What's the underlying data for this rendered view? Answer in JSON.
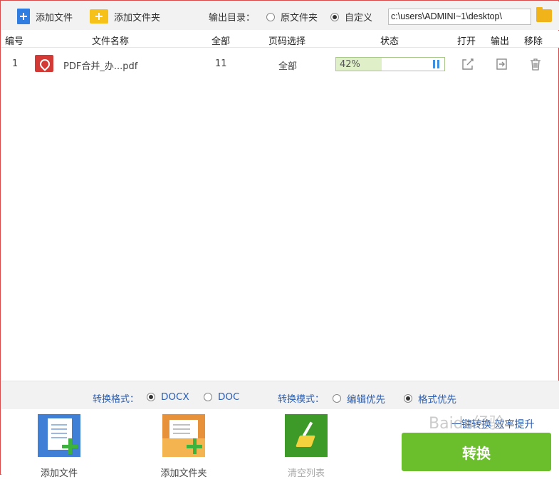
{
  "toolbar": {
    "add_file_label": "添加文件",
    "add_folder_label": "添加文件夹",
    "output_dir_label": "输出目录：",
    "radio_original": "原文件夹",
    "radio_custom": "自定义",
    "output_path": "c:\\users\\ADMINI~1\\desktop\\",
    "selected_output": "custom"
  },
  "table": {
    "headers": {
      "index": "编号",
      "filename": "文件名称",
      "total": "全部",
      "page_select": "页码选择",
      "status": "状态",
      "open": "打开",
      "output": "输出",
      "remove": "移除"
    },
    "rows": [
      {
        "index": "1",
        "filename": "PDF合并_办...pdf",
        "total": "11",
        "page_select": "全部",
        "progress_text": "42%",
        "progress": 0.42
      }
    ]
  },
  "options": {
    "format_label": "转换格式：",
    "format_docx": "DOCX",
    "format_doc": "DOC",
    "selected_format": "DOCX",
    "mode_label": "转换模式：",
    "mode_edit": "编辑优先",
    "mode_format": "格式优先",
    "selected_mode": "格式优先"
  },
  "footer": {
    "add_file_label": "添加文件",
    "add_folder_label": "添加文件夹",
    "clear_list_label": "清空列表",
    "slogan": "一键转换  效率提升",
    "convert_label": "转换",
    "watermark": "Baidu经验"
  },
  "colors": {
    "accent_blue": "#2a5db0",
    "convert_green": "#6cbf2c",
    "progress_fill": "#dff0c8",
    "window_border": "#d84a4a"
  }
}
